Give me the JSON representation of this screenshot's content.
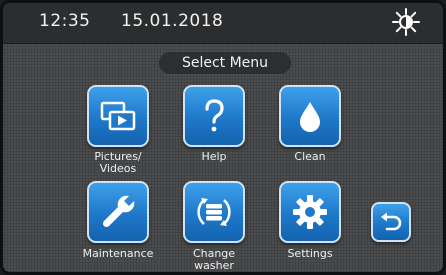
{
  "status": {
    "time": "12:35",
    "date": "15.01.2018",
    "brightness_icon": "sun-icon"
  },
  "menu": {
    "title": "Select Menu",
    "accent": "#1f78c9",
    "items": [
      {
        "id": "pictures-videos",
        "label": "Pictures/\nVideos",
        "icon": "pictures-videos-icon"
      },
      {
        "id": "help",
        "label": "Help",
        "icon": "help-icon"
      },
      {
        "id": "clean",
        "label": "Clean",
        "icon": "water-drop-icon"
      },
      {
        "id": "maintenance",
        "label": "Maintenance",
        "icon": "wrench-icon"
      },
      {
        "id": "change-washer",
        "label": "Change\nwasher",
        "icon": "change-washer-icon"
      },
      {
        "id": "settings",
        "label": "Settings",
        "icon": "gear-icon"
      }
    ],
    "back_icon": "back-arrow-icon"
  }
}
